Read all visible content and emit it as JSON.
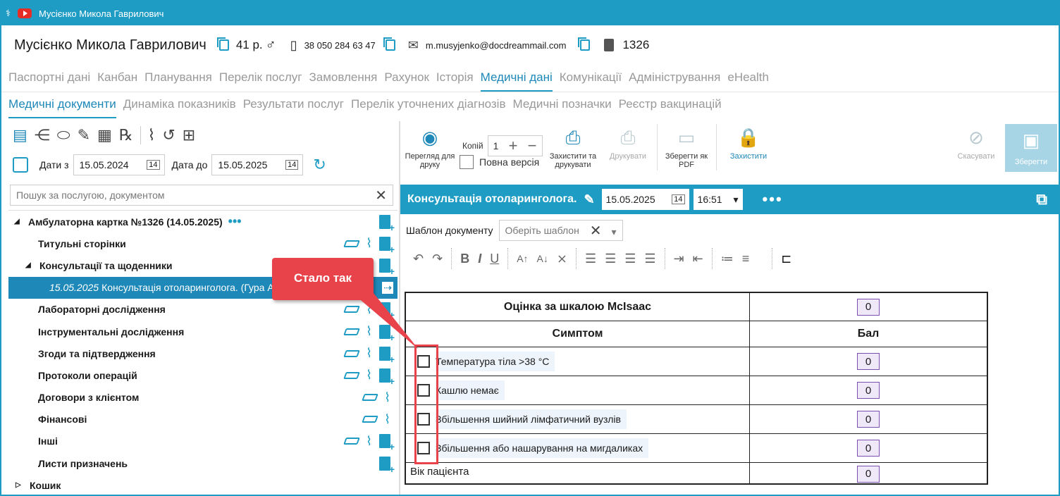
{
  "window": {
    "title": "Мусієнко Микола Гаврилович"
  },
  "patient": {
    "name": "Мусієнко Микола Гаврилович",
    "age": "41 р.",
    "gender_symbol": "♂",
    "phone": "38 050 284 63 47",
    "email": "m.musyjenko@docdreammail.com",
    "card_number": "1326"
  },
  "main_tabs": [
    "Паспортні дані",
    "Канбан",
    "Планування",
    "Перелік послуг",
    "Замовлення",
    "Рахунок",
    "Історія",
    "Медичні дані",
    "Комунікації",
    "Адміністрування",
    "eHealth"
  ],
  "main_tabs_active": "Медичні дані",
  "sub_tabs": [
    "Медичні документи",
    "Динаміка показників",
    "Результати послуг",
    "Перелік уточнених діагнозів",
    "Медичні позначки",
    "Реєстр вакцинацій"
  ],
  "sub_tabs_active": "Медичні документи",
  "filter": {
    "date_from_label": "Дати з",
    "date_from": "15.05.2024",
    "date_to_label": "Дата до",
    "date_to": "15.05.2025",
    "search_placeholder": "Пошук за послугою, документом"
  },
  "tree": {
    "root": "Амбулаторна картка №1326 (14.05.2025)",
    "items": [
      {
        "label": "Титульні сторінки",
        "level": 1,
        "icons": "scan,clip,doc"
      },
      {
        "label": "Консультації та щоденники",
        "level": 1,
        "expanded": true,
        "icons": "doc"
      },
      {
        "label": "Лабораторні дослідження",
        "level": 1,
        "icons": "scan,clip,doc"
      },
      {
        "label": "Інструментальні дослідження",
        "level": 1,
        "icons": "scan,clip,doc"
      },
      {
        "label": "Згоди та підтвердження",
        "level": 1,
        "icons": "scan,clip,doc"
      },
      {
        "label": "Протоколи операцій",
        "level": 1,
        "icons": "scan,clip,doc"
      },
      {
        "label": "Договори з клієнтом",
        "level": 1,
        "icons": "scan,clip"
      },
      {
        "label": "Фінансові",
        "level": 1,
        "icons": "scan,clip"
      },
      {
        "label": "Інші",
        "level": 1,
        "icons": "scan,clip,doc"
      },
      {
        "label": "Листи призначень",
        "level": 1,
        "icons": "doc"
      }
    ],
    "selected_date": "15.05.2025",
    "selected_label": "Консультація отоларинголога. (Гура А",
    "trash": "Кошик"
  },
  "toolbar": {
    "preview": "Перегляд для друку",
    "copies_label": "Копій",
    "copies_value": "1",
    "full_version": "Повна версія",
    "protect_print": "Захистити та друкувати",
    "print": "Друкувати",
    "save_pdf": "Зберегти як PDF",
    "protect": "Захистити",
    "cancel": "Скасувати",
    "save": "Зберегти"
  },
  "document": {
    "title": "Консультація отоларинголога.",
    "date": "15.05.2025",
    "time": "16:51",
    "template_label": "Шаблон документу",
    "template_placeholder": "Оберіть шаблон"
  },
  "table": {
    "title": "Оцінка за шкалою McIsaac",
    "title_score": "0",
    "col_symptom": "Симптом",
    "col_score": "Бал",
    "rows": [
      {
        "label": "Температура тіла >38 °C",
        "score": "0"
      },
      {
        "label": "Кашлю немає",
        "score": "0"
      },
      {
        "label": "Збільшення шийний лімфатичний вузлів",
        "score": "0"
      },
      {
        "label": "Збільшення або нашарування на мигдаликах",
        "score": "0"
      }
    ],
    "age_label": "Вік пацієнта",
    "age_score": "0"
  },
  "callout": {
    "text": "Стало так",
    "color": "#e8434a"
  },
  "colors": {
    "accent": "#1e9cc4",
    "highlight": "#e8434a"
  }
}
